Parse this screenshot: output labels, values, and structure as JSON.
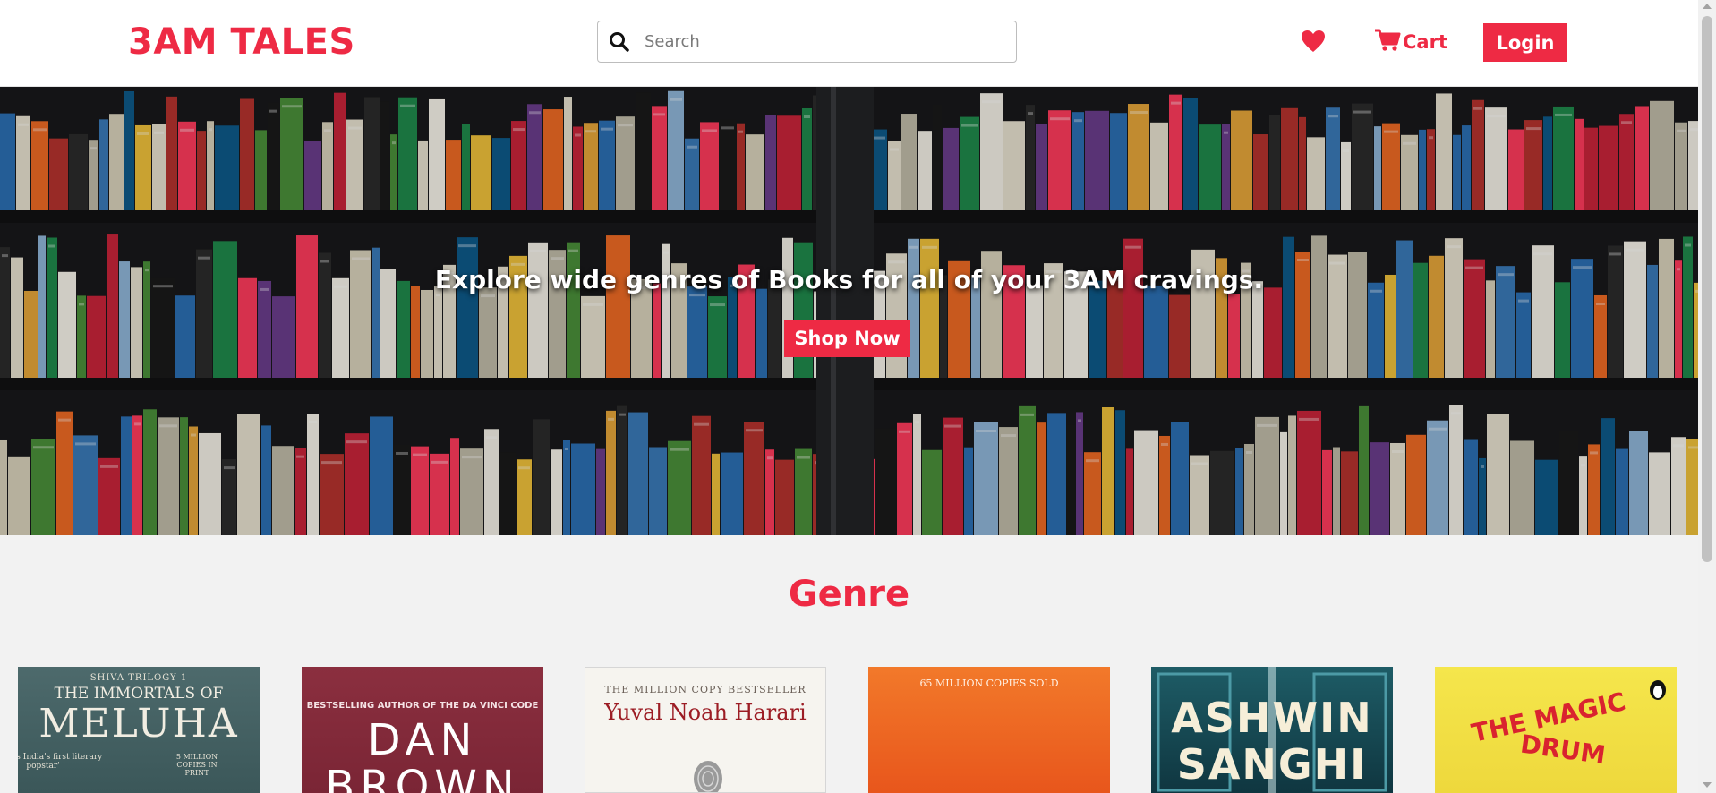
{
  "brand": {
    "logo_text": "3AM TALES",
    "accent_color": "#ee2a44"
  },
  "header": {
    "search": {
      "placeholder": "Search",
      "value": "",
      "icon": "search-icon"
    },
    "wishlist_icon": "heart-icon",
    "cart": {
      "icon": "cart-icon",
      "label": "Cart"
    },
    "login_label": "Login"
  },
  "hero": {
    "tagline": "Explore wide genres of Books for all of your 3AM cravings.",
    "cta_label": "Shop Now"
  },
  "genre": {
    "title": "Genre",
    "cards": [
      {
        "top_text": "SHIVA TRILOGY 1",
        "line1": "THE IMMORTALS OF",
        "line2": "MELUHA",
        "note1": "'Amish is India's first literary popstar'",
        "note2": "5 MILLION COPIES IN PRINT"
      },
      {
        "top_text": "BESTSELLING AUTHOR OF THE DA VINCI CODE",
        "line1": "DAN",
        "line2": "BROWN"
      },
      {
        "top_text": "THE MILLION COPY BESTSELLER",
        "line1": "Yuval Noah Harari"
      },
      {
        "top_text": "65 MILLION COPIES SOLD"
      },
      {
        "line1": "ASHWIN",
        "line2": "SANGHI"
      },
      {
        "line1": "THE MAGIC",
        "line2": "DRUM"
      }
    ]
  }
}
